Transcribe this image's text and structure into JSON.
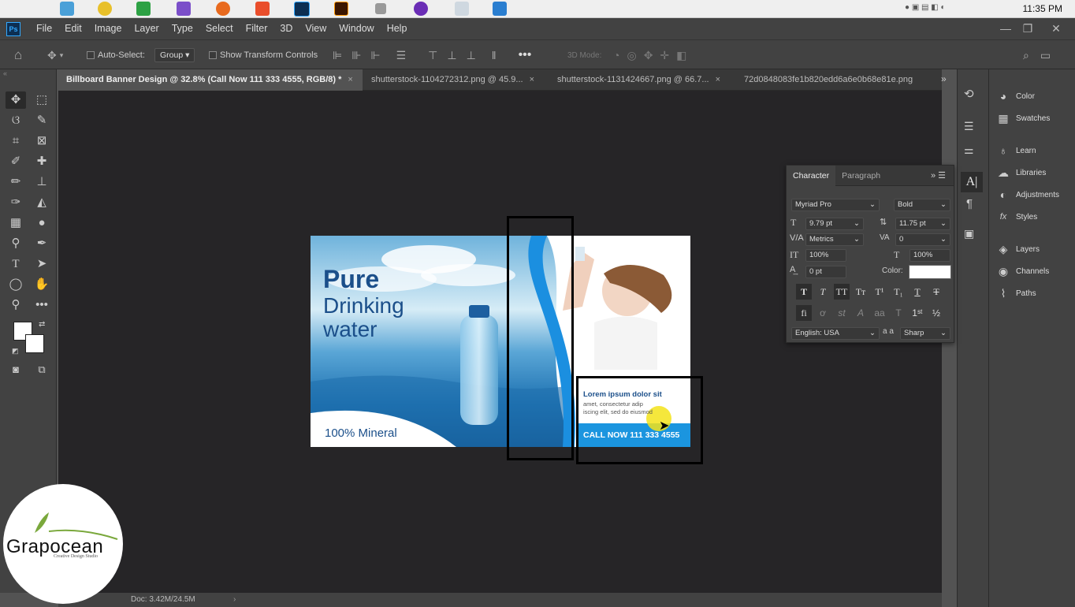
{
  "system": {
    "clock": "11:35 PM"
  },
  "menubar": {
    "app_badge": "Ps",
    "items": [
      "File",
      "Edit",
      "Image",
      "Layer",
      "Type",
      "Select",
      "Filter",
      "3D",
      "View",
      "Window",
      "Help"
    ]
  },
  "options": {
    "auto_select_label": "Auto-Select:",
    "auto_select_value": "Group",
    "transform_label": "Show Transform Controls",
    "mode_3d": "3D Mode:"
  },
  "tabs": [
    {
      "label": "Billboard Banner Design @ 32.8% (Call Now 111 333 4555, RGB/8) *",
      "active": true
    },
    {
      "label": "shutterstock-1104272312.png @ 45.9...",
      "active": false
    },
    {
      "label": "shutterstock-1131424667.png @ 66.7...",
      "active": false
    },
    {
      "label": "72d0848083fe1b820edd6a6e0b68e81e.png",
      "active": false
    }
  ],
  "status": {
    "doc": "Doc: 3.42M/24.5M"
  },
  "right_panel": {
    "items": [
      {
        "label": "Color",
        "icon": "color-wheel-icon"
      },
      {
        "label": "Swatches",
        "icon": "grid-icon"
      },
      {
        "label": "Learn",
        "icon": "bulb-icon"
      },
      {
        "label": "Libraries",
        "icon": "cloud-icon"
      },
      {
        "label": "Adjustments",
        "icon": "halfcircle-icon"
      },
      {
        "label": "Styles",
        "icon": "fx-icon"
      },
      {
        "label": "Layers",
        "icon": "layers-icon"
      },
      {
        "label": "Channels",
        "icon": "channels-icon"
      },
      {
        "label": "Paths",
        "icon": "pen-path-icon"
      }
    ]
  },
  "character": {
    "tab_character": "Character",
    "tab_paragraph": "Paragraph",
    "font_family": "Myriad Pro",
    "font_style": "Bold",
    "font_size": "9.79 pt",
    "leading": "11.75 pt",
    "kerning": "Metrics",
    "tracking": "0",
    "vscale": "100%",
    "hscale": "100%",
    "baseline": "0 pt",
    "color_label": "Color:",
    "language": "English: USA",
    "aa_label": "a a",
    "antialias": "Sharp"
  },
  "banner": {
    "heading_1": "Pure",
    "heading_2": "Drinking",
    "heading_3": "water",
    "mineral": "100% Mineral",
    "lorem_title": "Lorem ipsum dolor sit",
    "lorem_body_1": "amet, consectetur adip",
    "lorem_body_2": "iscing elit, sed do eiusmod",
    "call_now": "CALL NOW 111 333 4555"
  },
  "watermark": {
    "brand": "Grapocean",
    "tagline": "Creative Design Studio"
  }
}
